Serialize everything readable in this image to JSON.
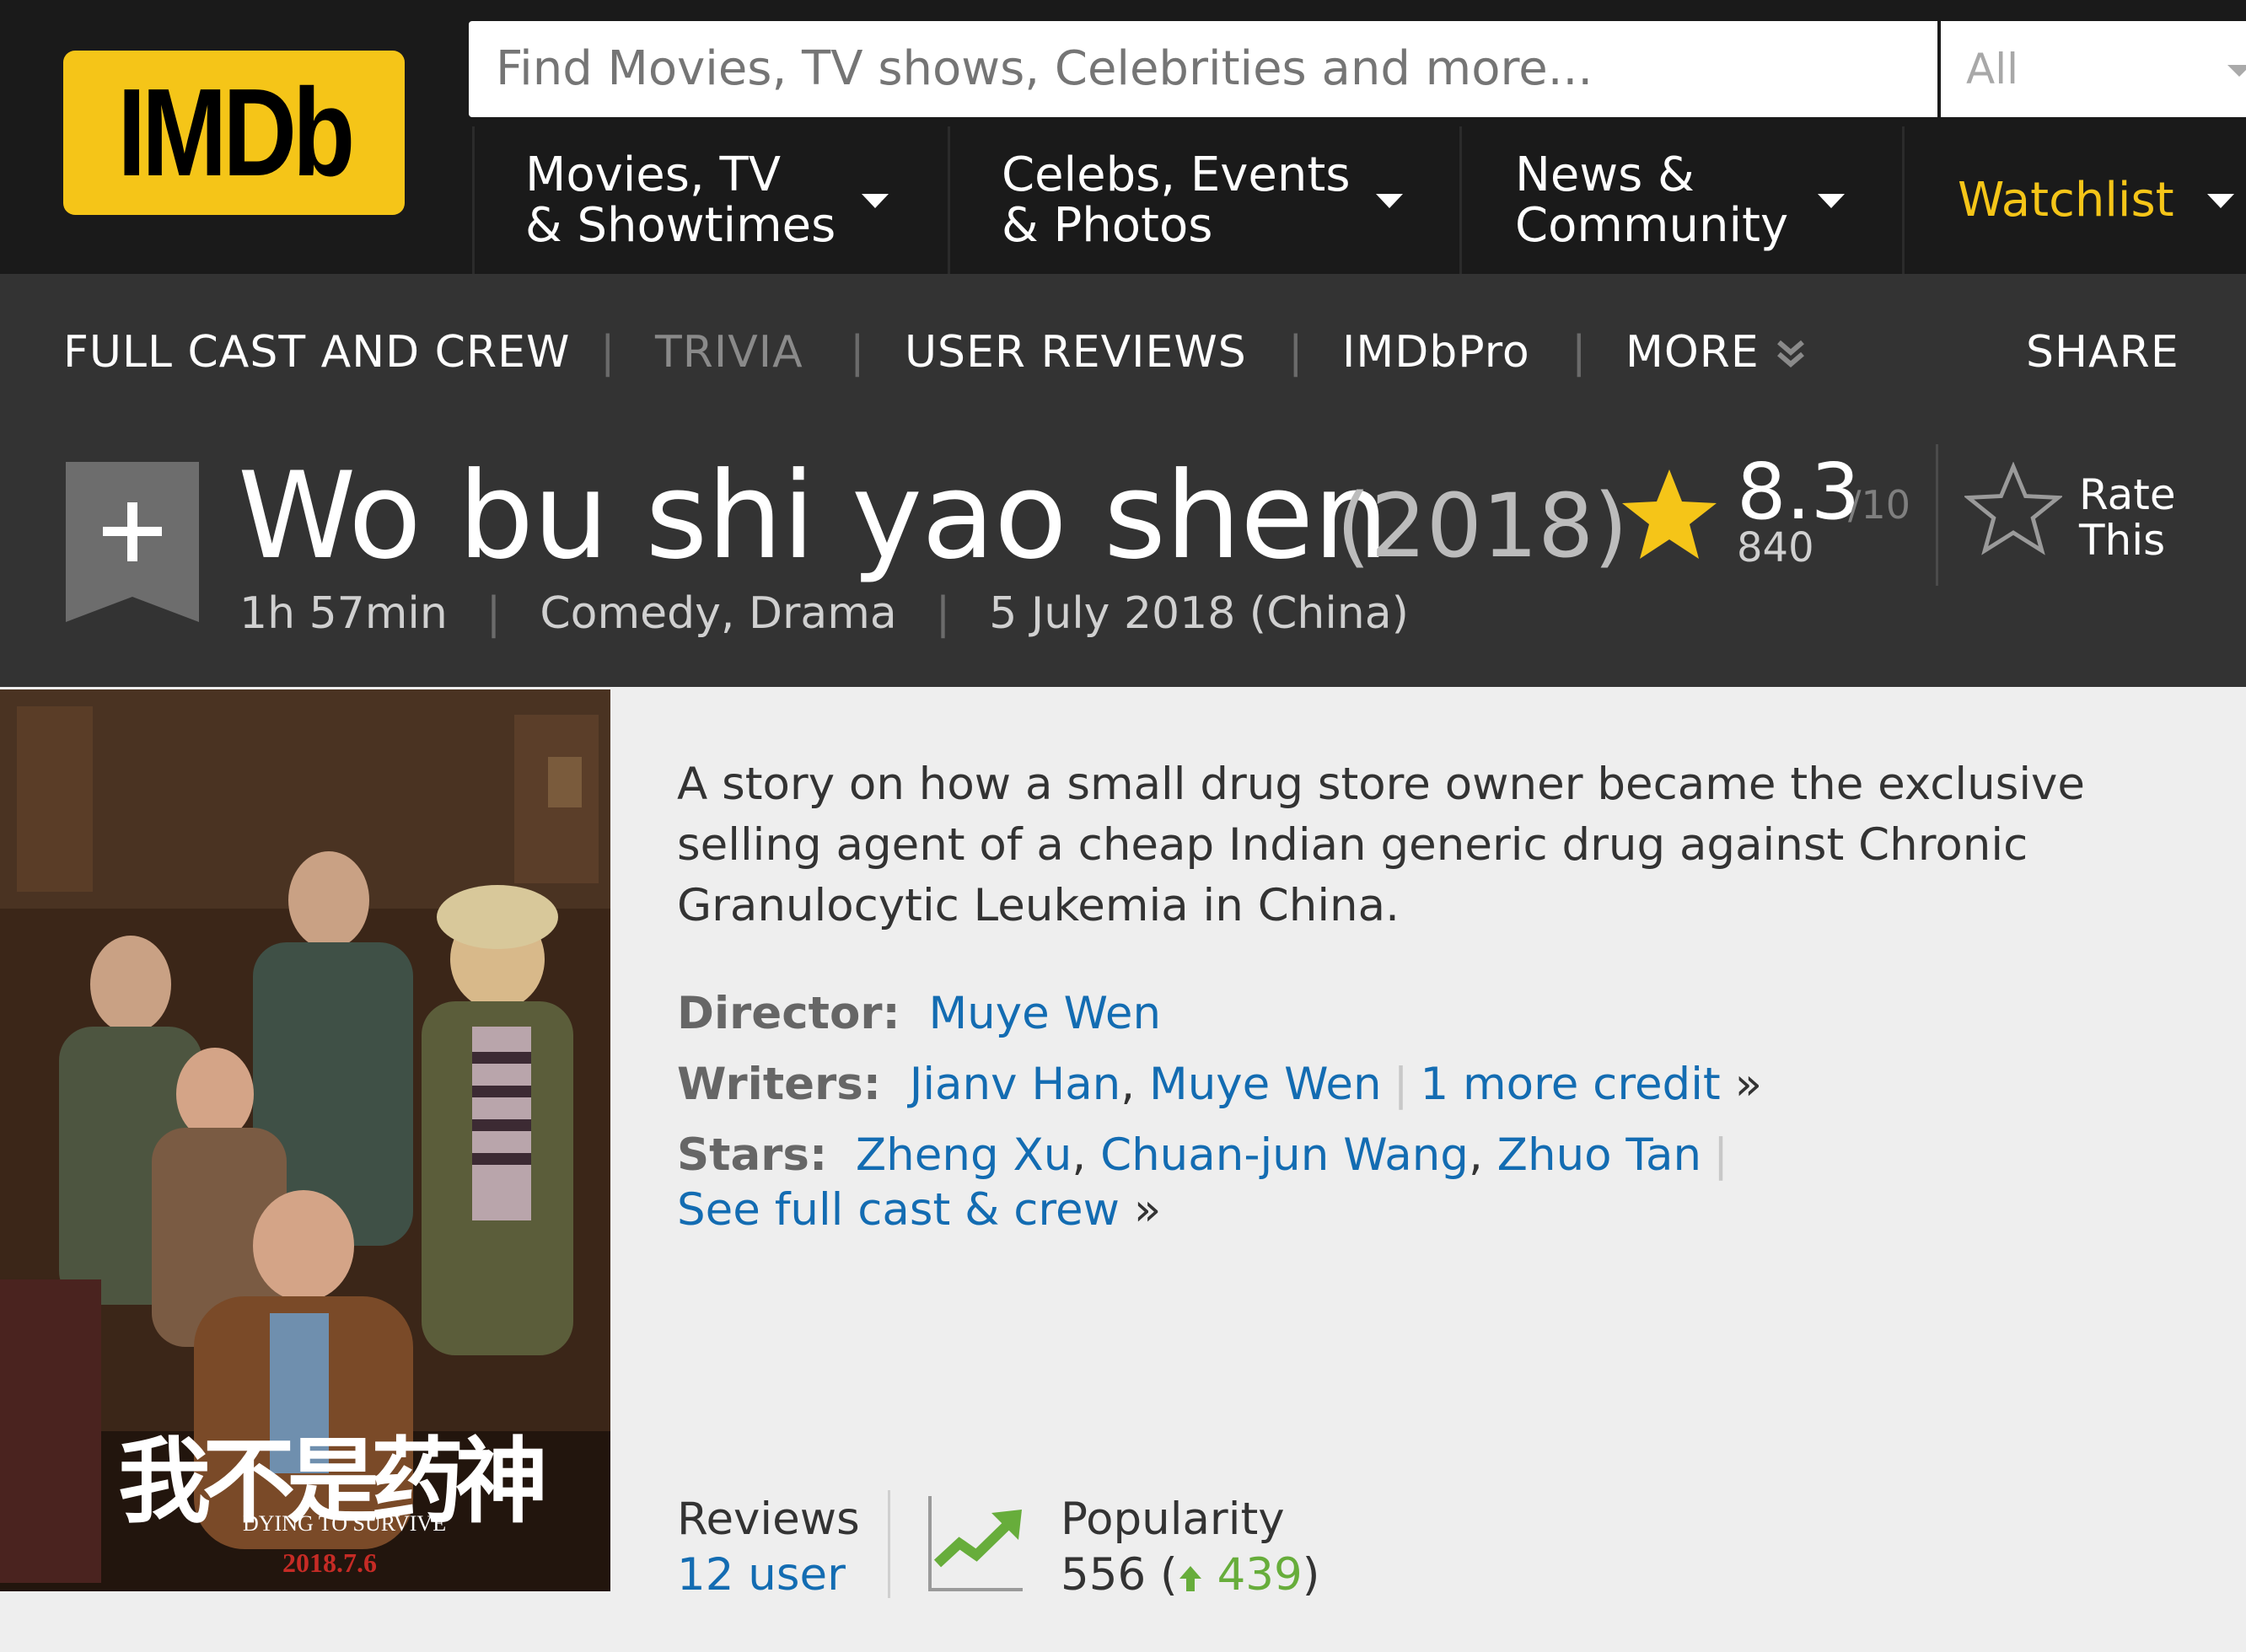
{
  "header": {
    "logo_text": "IMDb",
    "search_placeholder": "Find Movies, TV shows, Celebrities and more...",
    "search_category": "All",
    "nav": [
      {
        "label": "Movies, TV\n& Showtimes"
      },
      {
        "label": "Celebs, Events\n& Photos"
      },
      {
        "label": "News &\nCommunity"
      },
      {
        "label": "Watchlist"
      }
    ]
  },
  "subnav": {
    "full_cast": "FULL CAST AND CREW",
    "trivia": "TRIVIA",
    "user_reviews": "USER REVIEWS",
    "imdbpro": "IMDbPro",
    "more": "MORE",
    "share": "SHARE",
    "separator": "|"
  },
  "title_block": {
    "bookmark_icon": "add-to-watchlist-icon",
    "title": "Wo bu shi yao shen",
    "year": "(2018)",
    "runtime": "1h 57min",
    "genres": "Comedy, Drama",
    "release": "5 July 2018 (China)",
    "rating": "8.3",
    "rating_max": "/10",
    "votes": "840",
    "rate_label": "Rate\nThis"
  },
  "poster": {
    "title_cn": "我不是药神",
    "title_en": "DYING TO SURVIVE",
    "date": "2018.7.6"
  },
  "plot": "A story on how a small drug store owner became the exclusive selling agent of a cheap Indian generic drug against Chronic Granulocytic Leukemia in China.",
  "credits": {
    "director_label": "Director:",
    "director": "Muye Wen",
    "writers_label": "Writers:",
    "writer_1": "Jianv Han",
    "writer_2": "Muye Wen",
    "more_credit": "1 more credit",
    "stars_label": "Stars:",
    "star_1": "Zheng Xu",
    "star_2": "Chuan-jun Wang",
    "star_3": "Zhuo Tan",
    "see_full_cast": "See full cast & crew",
    "arrow": "»",
    "comma": ","
  },
  "reviews": {
    "title": "Reviews",
    "count": "12 user"
  },
  "popularity": {
    "title": "Popularity",
    "rank": "556",
    "change": "439",
    "trend": "up"
  },
  "colors": {
    "brand": "#f5c518",
    "link": "#136cb2",
    "watchlist": "#f5c518",
    "trend_up": "#67ad3b"
  }
}
